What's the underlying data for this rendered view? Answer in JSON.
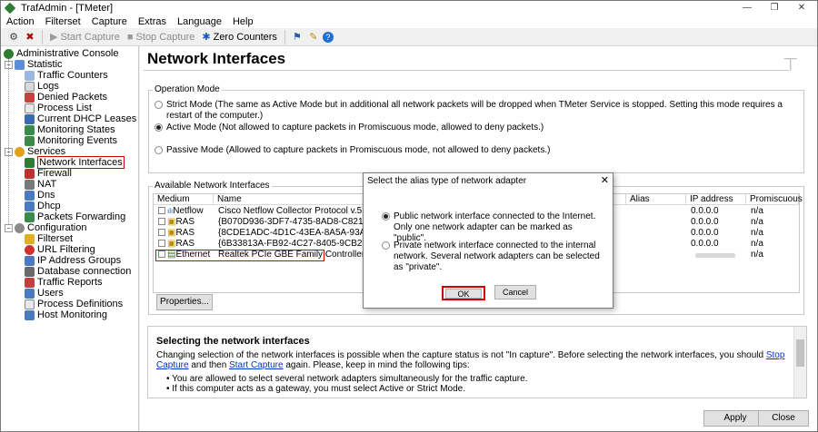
{
  "window": {
    "title": "TrafAdmin - [TMeter]",
    "controls": {
      "minimize": "—",
      "restore": "❐",
      "close": "✕"
    }
  },
  "menu": [
    "Action",
    "Filterset",
    "Capture",
    "Extras",
    "Language",
    "Help"
  ],
  "toolbar": {
    "start_capture": "Start Capture",
    "stop_capture": "Stop Capture",
    "zero_counters": "Zero Counters"
  },
  "tree": {
    "root": "Administrative Console",
    "statistic": {
      "label": "Statistic",
      "items": [
        "Traffic Counters",
        "Logs",
        "Denied Packets",
        "Process List",
        "Current DHCP Leases",
        "Monitoring States",
        "Monitoring Events"
      ]
    },
    "services": {
      "label": "Services",
      "items": [
        "Network Interfaces",
        "Firewall",
        "NAT",
        "Dns",
        "Dhcp",
        "Packets Forwarding"
      ]
    },
    "configuration": {
      "label": "Configuration",
      "items": [
        "Filterset",
        "URL Filtering",
        "IP Address Groups",
        "Database connection",
        "Traffic Reports",
        "Users",
        "Process Definitions",
        "Host Monitoring"
      ]
    }
  },
  "page": {
    "title": "Network Interfaces",
    "operation_mode": {
      "label": "Operation Mode",
      "options": [
        "Strict Mode (The same as Active Mode but in additional all network packets will be dropped when TMeter Service is stopped. Setting this mode requires a restart of the computer.)",
        "Active Mode (Not allowed to capture packets in Promiscuous mode, allowed to deny packets.)",
        "Passive Mode (Allowed to capture packets in Promiscuous mode, not allowed to deny packets.)"
      ],
      "selected_index": 1
    },
    "interfaces": {
      "label": "Available Network Interfaces",
      "columns": [
        "Medium",
        "Name",
        "Alias",
        "IP address",
        "Promiscuous"
      ],
      "rows": [
        {
          "medium": "Netflow",
          "name": "Cisco Netflow Collector Protocol v.5 (v.9)",
          "alias": "",
          "ip": "0.0.0.0",
          "promiscuous": "n/a"
        },
        {
          "medium": "RAS",
          "name": "{B070D936-3DF7-4735-8AD8-C8218B2D1682}",
          "alias": "",
          "ip": "0.0.0.0",
          "promiscuous": "n/a"
        },
        {
          "medium": "RAS",
          "name": "{8CDE1ADC-4D1C-43EA-8A5A-93AFAC1E787A}",
          "alias": "",
          "ip": "0.0.0.0",
          "promiscuous": "n/a"
        },
        {
          "medium": "RAS",
          "name": "{6B33813A-FB92-4C27-8405-9CB23D592C06}",
          "alias": "",
          "ip": "0.0.0.0",
          "promiscuous": "n/a"
        },
        {
          "medium": "Ethernet",
          "name": "Realtek PCIe GBE Family Controller",
          "alias": "",
          "ip": "",
          "promiscuous": "n/a"
        }
      ]
    },
    "properties_button": "Properties...",
    "tips": {
      "title": "Selecting the network interfaces",
      "p_part1": "Changing selection of the network interfaces is possible when the capture status is not \"In capture\". Before selecting the network interfaces, you should ",
      "link_stop": "Stop Capture",
      "p_part2": " and then ",
      "link_start": "Start Capture",
      "p_part3": " again. Please, keep in mind the following tips:",
      "bullets": [
        "You are allowed to select several network adapters simultaneously for the traffic capture.",
        "If this computer acts as a gateway, you must select Active or Strict Mode."
      ]
    },
    "apply_button": "Apply",
    "close_button": "Close"
  },
  "dialog": {
    "title": "Select the alias type of network adapter",
    "close": "✕",
    "options": [
      "Public network interface connected to the Internet. Only one network adapter can be marked as \"public\".",
      "Private network interface connected to the internal network. Several network adapters can be selected as \"private\"."
    ],
    "selected_index": 0,
    "ok": "OK",
    "cancel": "Cancel"
  },
  "colors": {
    "highlight_red": "#d00000",
    "link_blue": "#0033cc",
    "background": "#f0f0f0"
  }
}
